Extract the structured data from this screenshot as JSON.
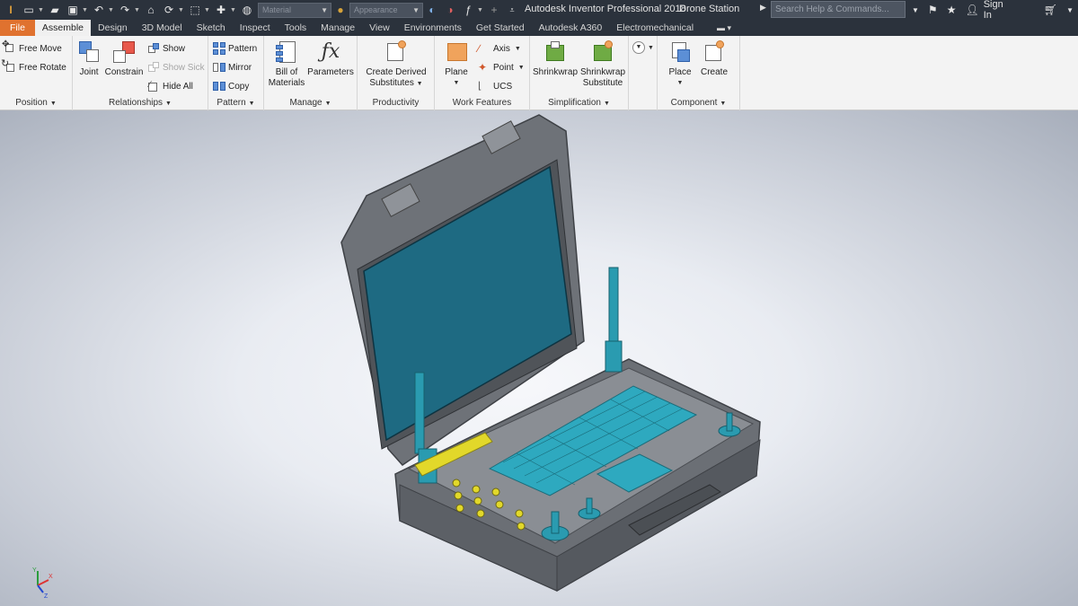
{
  "window": {
    "app_title": "Autodesk Inventor Professional 2018",
    "document_title": "Drone Station",
    "search_placeholder": "Search Help & Commands...",
    "sign_in": "Sign In",
    "material_combo": "Material",
    "appearance_combo": "Appearance"
  },
  "tabs": [
    {
      "label": "File"
    },
    {
      "label": "Assemble"
    },
    {
      "label": "Design"
    },
    {
      "label": "3D Model"
    },
    {
      "label": "Sketch"
    },
    {
      "label": "Inspect"
    },
    {
      "label": "Tools"
    },
    {
      "label": "Manage"
    },
    {
      "label": "View"
    },
    {
      "label": "Environments"
    },
    {
      "label": "Get Started"
    },
    {
      "label": "Autodesk A360"
    },
    {
      "label": "Electromechanical"
    }
  ],
  "active_tab": "Assemble",
  "ribbon": {
    "position": {
      "title": "Position",
      "free_move": "Free Move",
      "free_rotate": "Free Rotate"
    },
    "relationships": {
      "title": "Relationships",
      "joint": "Joint",
      "constrain": "Constrain",
      "show": "Show",
      "show_sick": "Show Sick",
      "hide_all": "Hide All"
    },
    "pattern": {
      "title": "Pattern",
      "pattern": "Pattern",
      "mirror": "Mirror",
      "copy": "Copy"
    },
    "manage": {
      "title": "Manage",
      "bom_line1": "Bill of",
      "bom_line2": "Materials",
      "parameters": "Parameters"
    },
    "productivity": {
      "title": "Productivity",
      "line1": "Create Derived",
      "line2": "Substitutes"
    },
    "work_features": {
      "title": "Work Features",
      "plane": "Plane",
      "axis": "Axis",
      "point": "Point",
      "ucs": "UCS"
    },
    "simplification": {
      "title": "Simplification",
      "shrinkwrap": "Shrinkwrap",
      "sw_sub_line1": "Shrinkwrap",
      "sw_sub_line2": "Substitute"
    },
    "component": {
      "title": "Component",
      "place": "Place",
      "create": "Create"
    }
  },
  "triad": {
    "x": "X",
    "y": "Y",
    "z": "Z"
  },
  "colors": {
    "file_tab": "#e0722f",
    "dark_chrome": "#2b323c",
    "ribbon_bg": "#f3f3f3",
    "model_teal": "#2a9bb0",
    "button_yellow": "#e2d82a"
  }
}
